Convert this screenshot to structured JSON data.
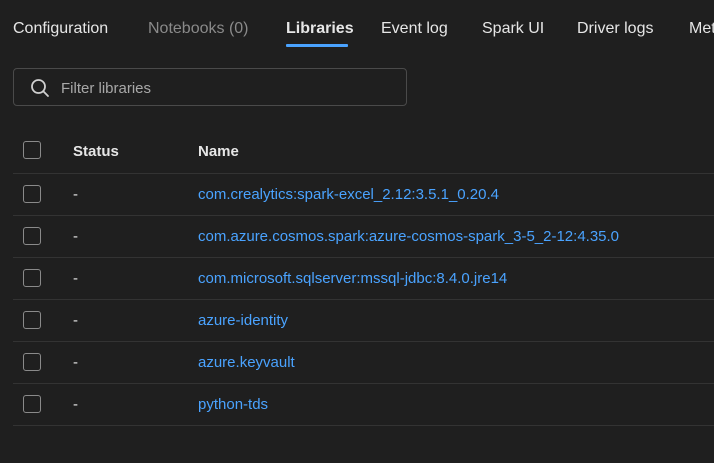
{
  "tabs": [
    {
      "label": "Configuration",
      "state": "normal"
    },
    {
      "label": "Notebooks (0)",
      "state": "disabled"
    },
    {
      "label": "Libraries",
      "state": "active"
    },
    {
      "label": "Event log",
      "state": "normal"
    },
    {
      "label": "Spark UI",
      "state": "normal"
    },
    {
      "label": "Driver logs",
      "state": "normal"
    },
    {
      "label": "Met",
      "state": "normal"
    }
  ],
  "search": {
    "placeholder": "Filter libraries",
    "icon": "search-icon"
  },
  "table": {
    "headers": {
      "status": "Status",
      "name": "Name"
    },
    "rows": [
      {
        "status": "-",
        "name": "com.crealytics:spark-excel_2.12:3.5.1_0.20.4"
      },
      {
        "status": "-",
        "name": "com.azure.cosmos.spark:azure-cosmos-spark_3-5_2-12:4.35.0"
      },
      {
        "status": "-",
        "name": "com.microsoft.sqlserver:mssql-jdbc:8.4.0.jre14"
      },
      {
        "status": "-",
        "name": "azure-identity"
      },
      {
        "status": "-",
        "name": "azure.keyvault"
      },
      {
        "status": "-",
        "name": "python-tds"
      }
    ]
  },
  "colors": {
    "background": "#1f1f1f",
    "link": "#4aa3ff",
    "accent": "#4aa3ff"
  }
}
